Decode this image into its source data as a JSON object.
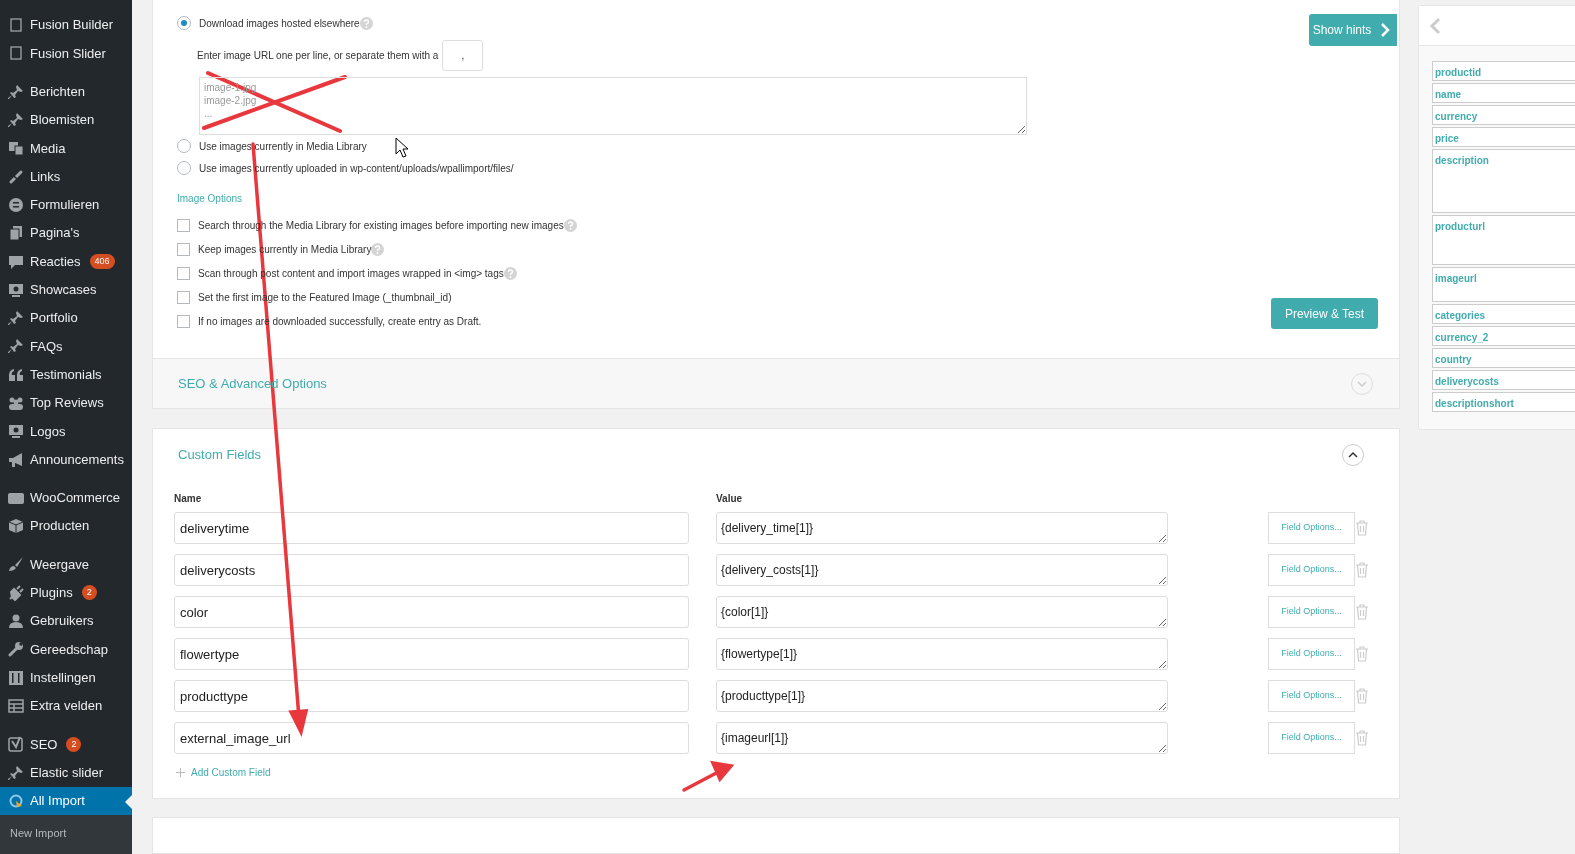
{
  "sidebar": {
    "groups": [
      [
        {
          "label": "Fusion Builder",
          "selected": false
        },
        {
          "label": "Fusion Slider",
          "selected": false
        }
      ],
      [
        {
          "label": "Berichten",
          "selected": false
        },
        {
          "label": "Bloemisten",
          "selected": false
        },
        {
          "label": "Media",
          "selected": false
        },
        {
          "label": "Links",
          "selected": false
        },
        {
          "label": "Formulieren",
          "selected": false
        },
        {
          "label": "Pagina's",
          "selected": false
        },
        {
          "label": "Reacties",
          "badge": "406",
          "selected": false
        },
        {
          "label": "Showcases",
          "selected": false
        },
        {
          "label": "Portfolio",
          "selected": false
        },
        {
          "label": "FAQs",
          "selected": false
        },
        {
          "label": "Testimonials",
          "selected": false
        },
        {
          "label": "Top Reviews",
          "selected": false
        },
        {
          "label": "Logos",
          "selected": false
        },
        {
          "label": "Announcements",
          "selected": false
        }
      ],
      [
        {
          "label": "WooCommerce",
          "selected": false
        },
        {
          "label": "Producten",
          "selected": false
        }
      ],
      [
        {
          "label": "Weergave",
          "selected": false
        },
        {
          "label": "Plugins",
          "badge": "2",
          "selected": false
        },
        {
          "label": "Gebruikers",
          "selected": false
        },
        {
          "label": "Gereedschap",
          "selected": false
        },
        {
          "label": "Instellingen",
          "selected": false
        },
        {
          "label": "Extra velden",
          "selected": false
        }
      ],
      [
        {
          "label": "SEO",
          "badge": "2",
          "selected": false
        },
        {
          "label": "Elastic slider",
          "selected": false
        },
        {
          "label": "All Import",
          "selected": true
        }
      ]
    ],
    "submenu": [
      {
        "label": "New Import",
        "selected": false
      }
    ]
  },
  "images": {
    "sources": [
      {
        "label": "Download images hosted elsewhere",
        "selected": true,
        "help": true
      },
      {
        "label": "Use images currently in Media Library",
        "selected": false,
        "help": false
      },
      {
        "label": "Use images currently uploaded in wp-content/uploads/wpallimport/files/",
        "selected": false,
        "help": false
      }
    ],
    "url_hint": "Enter image URL one per line, or separate them with a",
    "separator_field": {
      "value": ","
    },
    "url_list": {
      "placeholder": "image-1.jpg\nimage-2.jpg\n..."
    }
  },
  "image_options": {
    "title": "Image Options",
    "options": [
      {
        "label": "Search through the Media Library for existing images before importing new images",
        "checked": false,
        "help": true
      },
      {
        "label": "Keep images currently in Media Library",
        "checked": false,
        "help": true
      },
      {
        "label": "Scan through post content and import images wrapped in <img> tags",
        "checked": false,
        "help": true
      },
      {
        "label": "Set the first image to the Featured Image (_thumbnail_id)",
        "checked": false,
        "help": false
      },
      {
        "label": "If no images are downloaded successfully, create entry as Draft.",
        "checked": false,
        "help": false
      }
    ]
  },
  "show_hints_button": "Show hints",
  "preview_button": "Preview & Test",
  "seo_section": {
    "title": "SEO & Advanced Options",
    "expanded": false
  },
  "custom_fields": {
    "title": "Custom Fields",
    "expanded": true,
    "columns": [
      "Name",
      "Value"
    ],
    "rows": [
      {
        "name": "deliverytime",
        "value": "{delivery_time[1]}",
        "options": "Field Options..."
      },
      {
        "name": "deliverycosts",
        "value": "{delivery_costs[1]}",
        "options": "Field Options..."
      },
      {
        "name": "color",
        "value": "{color[1]}",
        "options": "Field Options..."
      },
      {
        "name": "flowertype",
        "value": "{flowertype[1]}",
        "options": "Field Options..."
      },
      {
        "name": "producttype",
        "value": "{producttype[1]}",
        "options": "Field Options..."
      },
      {
        "name": "external_image_url",
        "value": "{imageurl[1]}",
        "options": "Field Options..."
      }
    ],
    "add_link": "Add Custom Field"
  },
  "field_list": {
    "items": [
      "productid",
      "name",
      "currency",
      "price",
      "description",
      "producturl",
      "imageurl",
      "categories",
      "currency_2",
      "country",
      "deliverycosts",
      "descriptionshort"
    ]
  }
}
